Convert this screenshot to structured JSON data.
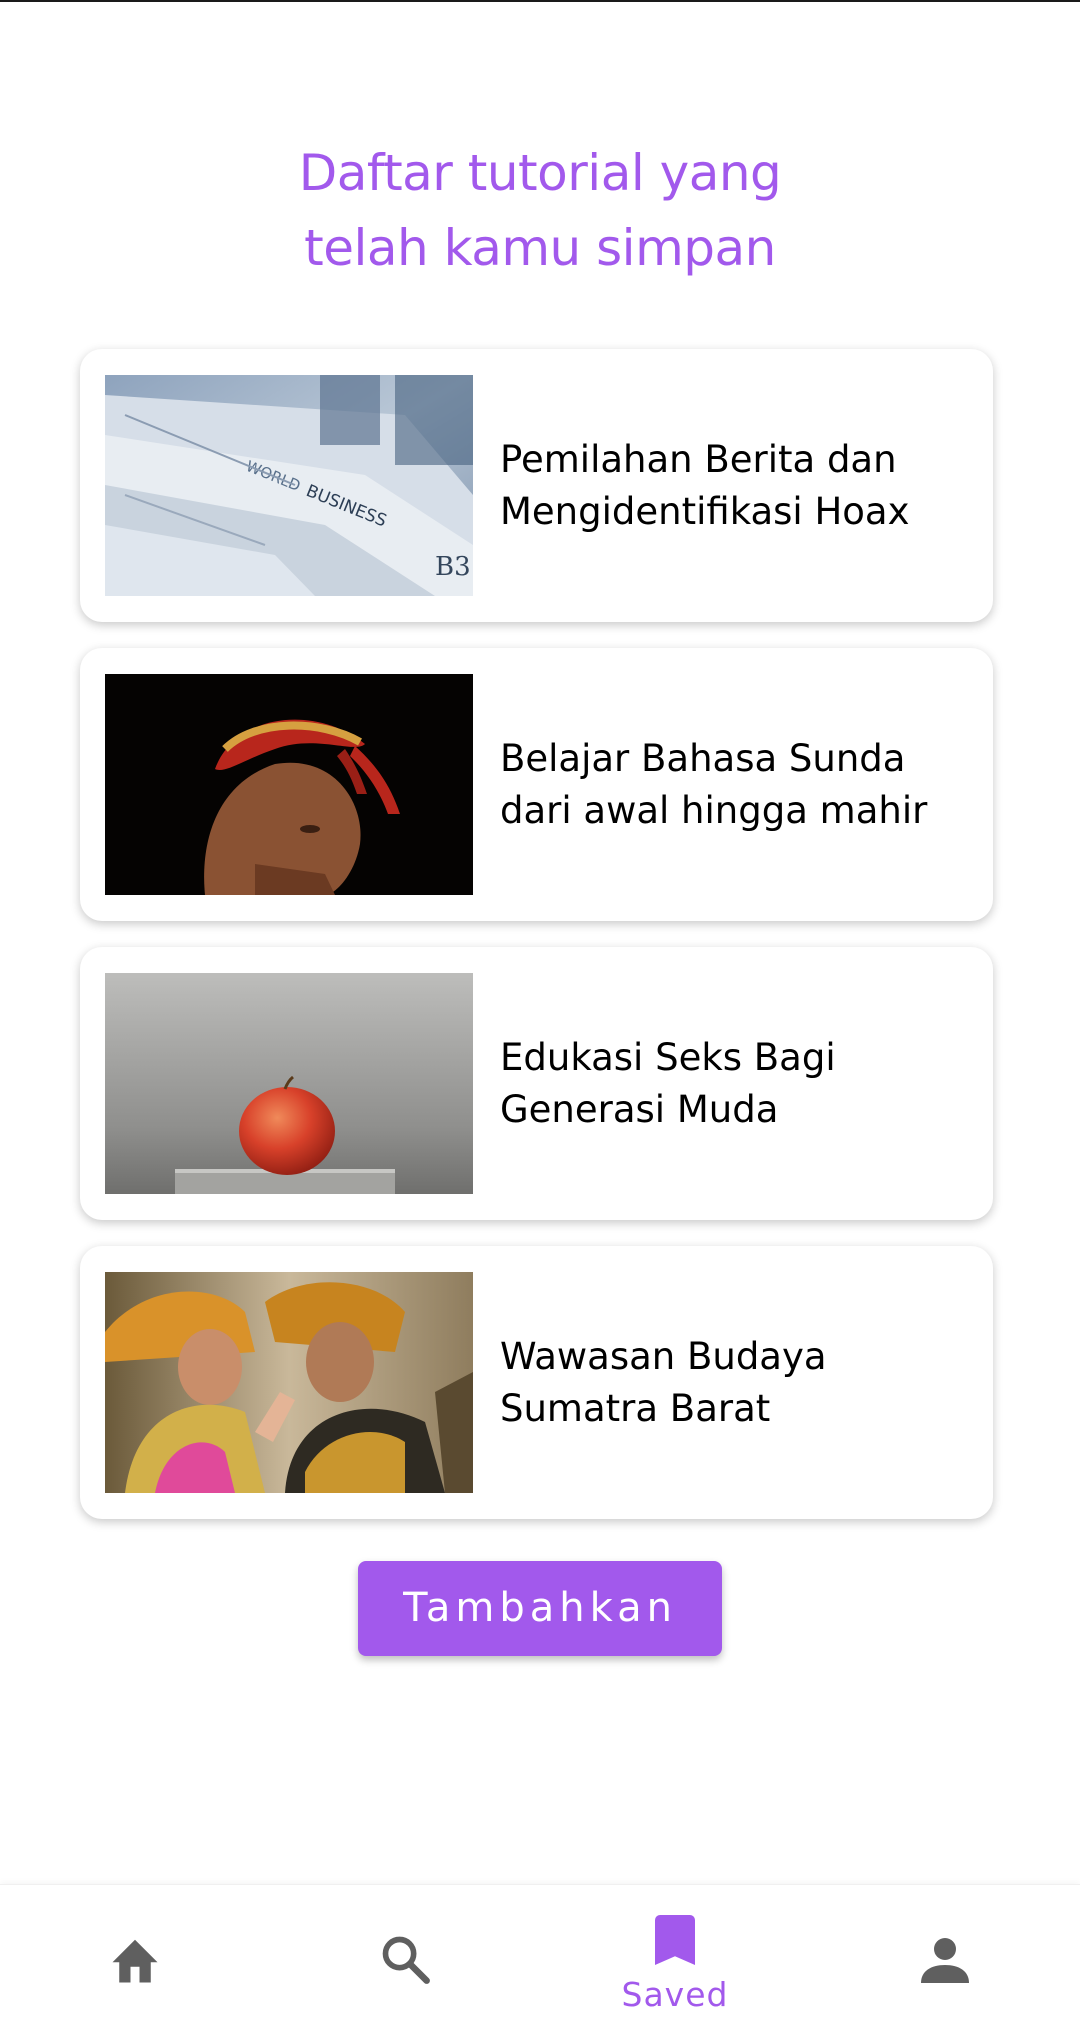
{
  "page": {
    "title_line1": "Daftar tutorial yang",
    "title_line2": "telah kamu simpan",
    "accent_color": "#a259ec"
  },
  "tutorials": [
    {
      "title_line1": "Pemilahan Berita dan",
      "title_line2": "Mengidentifikasi Hoax",
      "image": "newspapers-photo"
    },
    {
      "title_line1": "Belajar Bahasa Sunda",
      "title_line2": "dari awal hingga mahir",
      "image": "sundanese-man-headband-photo"
    },
    {
      "title_line1": "Edukasi Seks Bagi",
      "title_line2": "Generasi Muda",
      "image": "red-apple-photo"
    },
    {
      "title_line1": "Wawasan Budaya",
      "title_line2": "Sumatra Barat",
      "image": "traditional-dancers-photo"
    }
  ],
  "add_button": {
    "label": "Tambahkan"
  },
  "bottom_nav": {
    "items": [
      {
        "icon": "home-icon",
        "label": "",
        "active": false
      },
      {
        "icon": "search-icon",
        "label": "",
        "active": false
      },
      {
        "icon": "bookmark-icon",
        "label": "Saved",
        "active": true
      },
      {
        "icon": "person-icon",
        "label": "",
        "active": false
      }
    ]
  }
}
